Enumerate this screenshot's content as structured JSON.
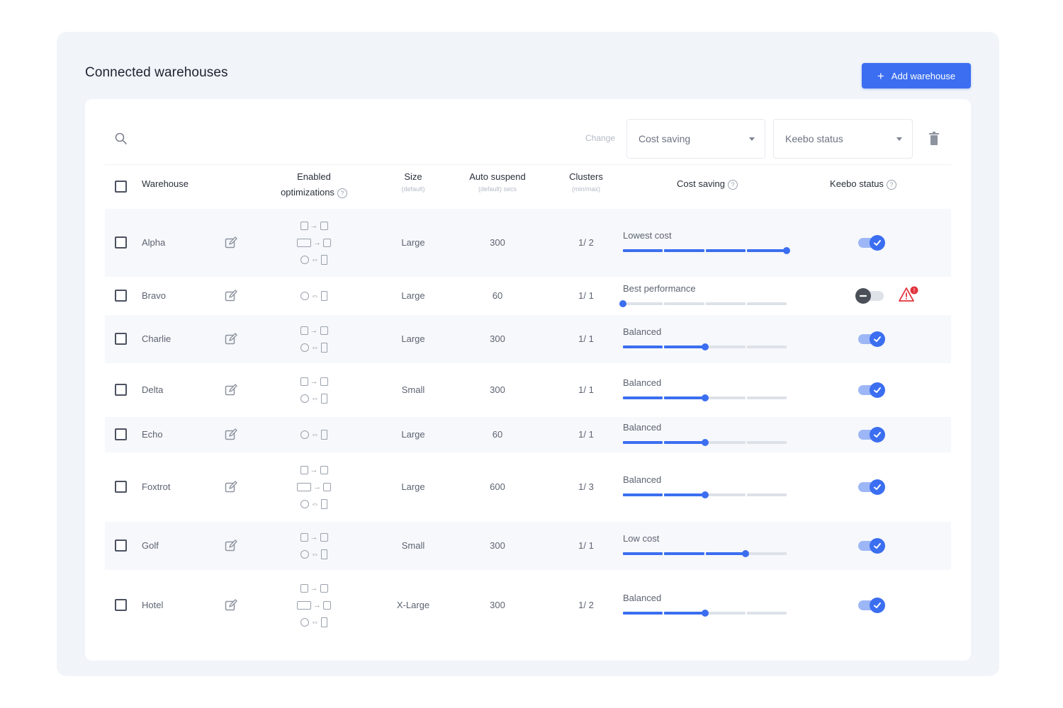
{
  "page": {
    "title": "Connected warehouses",
    "add_button": "Add warehouse"
  },
  "toolbar": {
    "change_label": "Change",
    "cost_select": "Cost saving",
    "status_select": "Keebo status"
  },
  "columns": {
    "warehouse": "Warehouse",
    "enabled_line1": "Enabled",
    "enabled_line2": "optimizations",
    "size": "Size",
    "size_sub": "(default)",
    "auto_suspend": "Auto suspend",
    "auto_suspend_sub": "(default) secs",
    "clusters": "Clusters",
    "clusters_sub": "(min/max)",
    "cost_saving": "Cost saving",
    "keebo_status": "Keebo status"
  },
  "rows": [
    {
      "name": "Alpha",
      "opts": [
        "db-arrow",
        "db2-arrow",
        "circ-bar"
      ],
      "size": "Large",
      "suspend": "300",
      "clusters": "1/ 2",
      "cost_label": "Lowest cost",
      "level": 1.0,
      "on": true,
      "warning": false
    },
    {
      "name": "Bravo",
      "opts": [
        "circ-bar"
      ],
      "size": "Large",
      "suspend": "60",
      "clusters": "1/ 1",
      "cost_label": "Best performance",
      "level": 0.0,
      "on": false,
      "warning": true
    },
    {
      "name": "Charlie",
      "opts": [
        "db-arrow",
        "circ-bar"
      ],
      "size": "Large",
      "suspend": "300",
      "clusters": "1/ 1",
      "cost_label": "Balanced",
      "level": 0.5,
      "on": true,
      "warning": false
    },
    {
      "name": "Delta",
      "opts": [
        "db-arrow",
        "circ-bar"
      ],
      "size": "Small",
      "suspend": "300",
      "clusters": "1/ 1",
      "cost_label": "Balanced",
      "level": 0.5,
      "on": true,
      "warning": false
    },
    {
      "name": "Echo",
      "opts": [
        "circ-bar"
      ],
      "size": "Large",
      "suspend": "60",
      "clusters": "1/ 1",
      "cost_label": "Balanced",
      "level": 0.5,
      "on": true,
      "warning": false
    },
    {
      "name": "Foxtrot",
      "opts": [
        "db-arrow",
        "db2-arrow",
        "circ-bar"
      ],
      "size": "Large",
      "suspend": "600",
      "clusters": "1/ 3",
      "cost_label": "Balanced",
      "level": 0.5,
      "on": true,
      "warning": false
    },
    {
      "name": "Golf",
      "opts": [
        "db-arrow",
        "circ-bar"
      ],
      "size": "Small",
      "suspend": "300",
      "clusters": "1/ 1",
      "cost_label": "Low cost",
      "level": 0.75,
      "on": true,
      "warning": false
    },
    {
      "name": "Hotel",
      "opts": [
        "db-arrow",
        "db2-arrow",
        "circ-bar"
      ],
      "size": "X-Large",
      "suspend": "300",
      "clusters": "1/ 2",
      "cost_label": "Balanced",
      "level": 0.5,
      "on": true,
      "warning": false
    }
  ],
  "colors": {
    "accent": "#3b6ef0",
    "warning": "#e2333d"
  },
  "icons": {
    "search": "search-icon",
    "trash": "trash-icon",
    "edit": "edit-icon",
    "check": "check-icon",
    "warning": "warning-icon"
  }
}
